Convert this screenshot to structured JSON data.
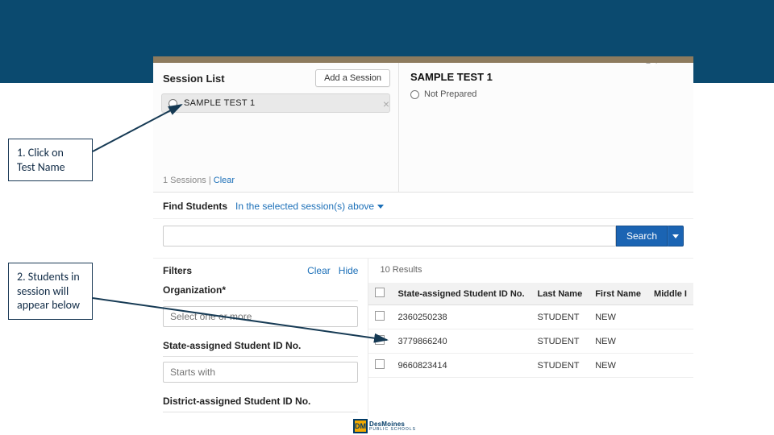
{
  "callouts": {
    "one": "1. Click on Test Name",
    "two": "2. Students in session will appear below"
  },
  "session_list": {
    "title": "Session List",
    "add_button": "Add a Session",
    "items": [
      {
        "label": "SAMPLE TEST 1"
      }
    ],
    "footer_count": "1 Sessions |",
    "footer_clear": "Clear"
  },
  "detail": {
    "title": "SAMPLE TEST 1",
    "status": "Not Prepared"
  },
  "find_students": {
    "label": "Find Students",
    "scope": "In the selected session(s) above",
    "search_button": "Search"
  },
  "filters": {
    "title": "Filters",
    "clear": "Clear",
    "hide": "Hide",
    "organization_label": "Organization*",
    "organization_placeholder": "Select one or more",
    "state_id_label": "State-assigned Student ID No.",
    "state_id_placeholder": "Starts with",
    "district_id_label": "District-assigned Student ID No."
  },
  "results": {
    "count_text": "10 Results",
    "columns": {
      "state_id": "State-assigned Student ID No.",
      "last_name": "Last Name",
      "first_name": "First Name",
      "middle": "Middle I"
    },
    "rows": [
      {
        "state_id": "2360250238",
        "last_name": "STUDENT",
        "first_name": "NEW"
      },
      {
        "state_id": "3779866240",
        "last_name": "STUDENT",
        "first_name": "NEW"
      },
      {
        "state_id": "9660823414",
        "last_name": "STUDENT",
        "first_name": "NEW"
      }
    ]
  },
  "logo": {
    "mark": "DM",
    "line1": "DesMoines",
    "line2": "PUBLIC SCHOOLS"
  }
}
